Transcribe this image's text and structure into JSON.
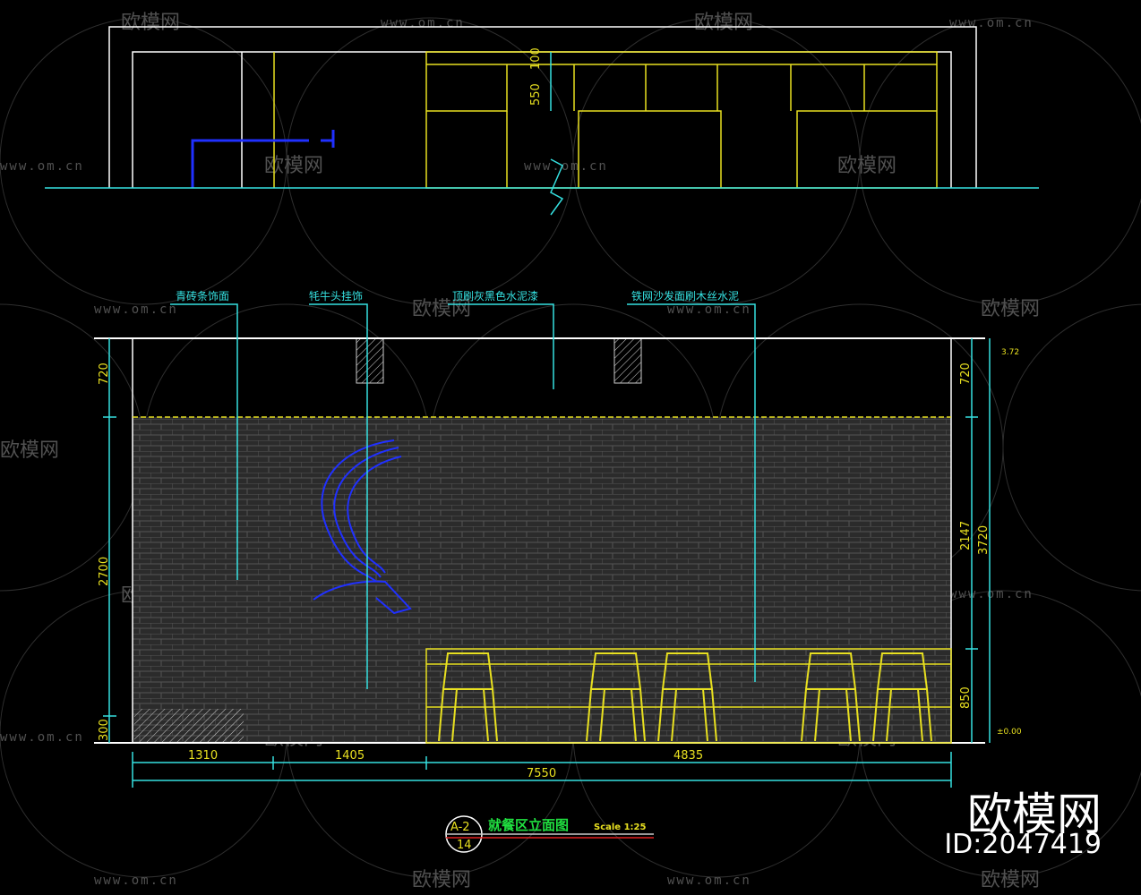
{
  "drawing": {
    "title": "就餐区立面图",
    "scale": "Scale 1:25",
    "ref_top": "A-2",
    "ref_bottom": "14",
    "callouts": [
      "青砖条饰面",
      "牦牛头挂饰",
      "顶刷灰黑色水泥漆",
      "铁网沙发面刷木丝水泥"
    ],
    "top_dims": [
      "100",
      "550"
    ],
    "left_dims": [
      "720",
      "2700",
      "300"
    ],
    "right_dims": [
      "720",
      "2147",
      "850"
    ],
    "right_total": "3720",
    "bottom_dims": [
      "1310",
      "1405",
      "4835"
    ],
    "bottom_total": "7550",
    "level_top": "3.72",
    "level_bottom": "±0.00"
  },
  "watermark": {
    "brand": "欧模网",
    "site": "www.om.cn",
    "id": "ID:2047419"
  },
  "colors": {
    "cyan": "#35e0e0",
    "yellow": "#e8e020",
    "blue": "#2030ff",
    "green": "#20e040",
    "white": "#ffffff",
    "red": "#e02020"
  }
}
